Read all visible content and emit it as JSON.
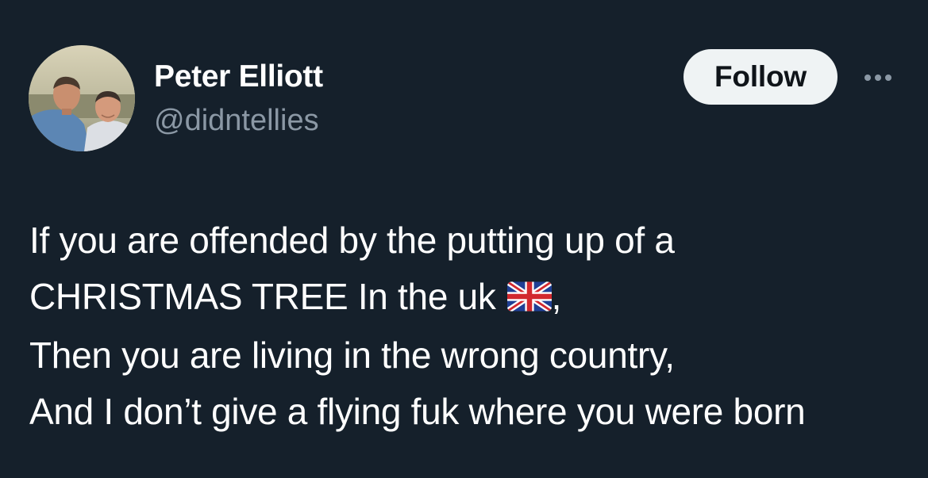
{
  "author": {
    "display_name": "Peter Elliott",
    "handle": "@didntellies"
  },
  "actions": {
    "follow_label": "Follow",
    "more_icon": "more-horizontal-icon"
  },
  "tweet": {
    "line1": "If you are offended by the putting up of a",
    "line2_text": "CHRISTMAS TREE In the uk",
    "line2_flag_icon": "uk-flag-emoji",
    "line2_suffix": ",",
    "line3": "Then you are living in the wrong country,",
    "line4": "And I don’t give a flying fuk where you were born"
  },
  "colors": {
    "background": "#15202b",
    "text_primary": "#ffffff",
    "text_secondary": "#8b98a5",
    "follow_button_bg": "#eff3f4",
    "follow_button_text": "#0f1419"
  }
}
